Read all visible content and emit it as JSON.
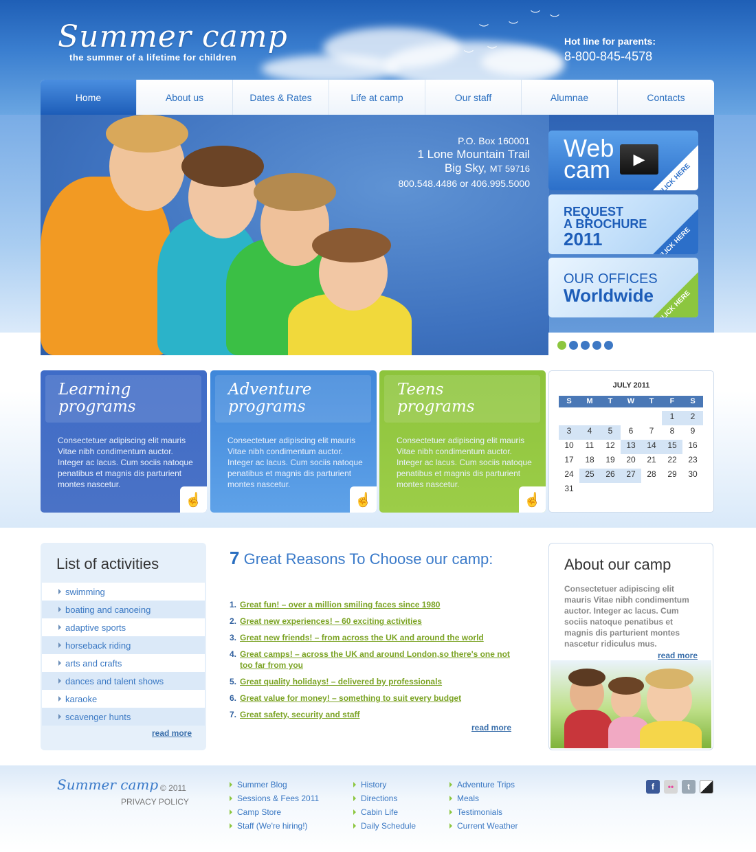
{
  "header": {
    "logo_title": "Summer camp",
    "tagline": "the summer of a lifetime for children",
    "hotline_label": "Hot line for parents:",
    "hotline_number": "8-800-845-4578"
  },
  "nav": {
    "items": [
      {
        "label": "Home",
        "active": true
      },
      {
        "label": "About us"
      },
      {
        "label": "Dates & Rates"
      },
      {
        "label": "Life at camp"
      },
      {
        "label": "Our staff"
      },
      {
        "label": "Alumnae"
      },
      {
        "label": "Contacts"
      }
    ]
  },
  "address": {
    "pobox": "P.O. Box 160001",
    "street": "1 Lone Mountain Trail",
    "city": "Big Sky,",
    "state": "MT 59716",
    "phones": "800.548.4486 or 406.995.5000"
  },
  "promos": {
    "webcam": {
      "line1": "Web",
      "line2": "cam",
      "corner": "CLICK HERE"
    },
    "brochure": {
      "line1": "REQUEST",
      "line2": "A BROCHURE",
      "line3": "2011",
      "corner": "CLICK HERE"
    },
    "offices": {
      "line1": "OUR OFFICES",
      "line2": "Worldwide",
      "corner": "CLICK HERE"
    }
  },
  "slider": {
    "count": 5,
    "active_index": 0
  },
  "cards": [
    {
      "title_l1": "Learning",
      "title_l2": "programs",
      "text": "Consectetuer adipiscing elit mauris Vitae nibh condimentum auctor. Integer ac lacus. Cum sociis natoque penatibus et magnis dis parturient montes nascetur."
    },
    {
      "title_l1": "Adventure",
      "title_l2": "programs",
      "text": "Consectetuer adipiscing elit mauris Vitae nibh condimentum auctor. Integer ac lacus. Cum sociis natoque penatibus et magnis dis parturient montes nascetur."
    },
    {
      "title_l1": "Teens",
      "title_l2": "programs",
      "text": "Consectetuer adipiscing elit mauris Vitae nibh condimentum auctor. Integer ac lacus. Cum sociis natoque penatibus et magnis dis parturient montes nascetur."
    }
  ],
  "calendar": {
    "month": "JULY 2011",
    "weekdays": [
      "S",
      "M",
      "T",
      "W",
      "T",
      "F",
      "S"
    ],
    "weeks": [
      [
        "",
        "",
        "",
        "",
        "",
        "1",
        "2"
      ],
      [
        "3",
        "4",
        "5",
        "6",
        "7",
        "8",
        "9"
      ],
      [
        "10",
        "11",
        "12",
        "13",
        "14",
        "15",
        "16"
      ],
      [
        "17",
        "18",
        "19",
        "20",
        "21",
        "22",
        "23"
      ],
      [
        "24",
        "25",
        "26",
        "27",
        "28",
        "29",
        "30"
      ],
      [
        "31",
        "",
        "",
        "",
        "",
        "",
        ""
      ]
    ],
    "highlighted": [
      "1",
      "2",
      "3",
      "4",
      "5",
      "13",
      "14",
      "15",
      "25",
      "26",
      "27"
    ]
  },
  "activities": {
    "title": "List of activities",
    "items": [
      "swimming",
      "boating and canoeing",
      "adaptive sports",
      "horseback riding",
      "arts and crafts",
      "dances and talent shows",
      "karaoke",
      "scavenger hunts"
    ],
    "read_more": "read more"
  },
  "reasons": {
    "number": "7",
    "title": "Great Reasons To Choose our camp:",
    "items": [
      "Great fun! – over a million smiling faces since 1980",
      "Great new experiences! – 60 exciting activities",
      "Great new friends! – from across the UK and around the world",
      "Great camps! – across the UK and around London,so there's one not too far from you",
      "Great quality holidays! – delivered by professionals",
      "Great value for money! – something to suit every budget",
      "Great safety, security and staff"
    ],
    "read_more": "read more"
  },
  "about": {
    "title": "About our camp",
    "text": "Consectetuer adipiscing elit mauris  Vitae nibh condimentum auctor. Integer ac lacus. Cum sociis natoque penatibus et magnis dis parturient montes nascetur ridiculus mus.",
    "read_more": "read more"
  },
  "footer": {
    "logo": "Summer camp",
    "copyright": "© 2011",
    "privacy": "PRIVACY POLICY",
    "col1": [
      "Summer Blog",
      "Sessions & Fees 2011",
      "Camp Store",
      "Staff (We're hiring!)"
    ],
    "col2": [
      "History",
      "Directions",
      "Cabin Life",
      "Daily Schedule"
    ],
    "col3": [
      "Adventure Trips",
      "Meals",
      "Testimonials",
      "Current Weather"
    ],
    "social": [
      {
        "icon": "facebook-icon",
        "glyph": "f",
        "color": "#3b5998"
      },
      {
        "icon": "flickr-icon",
        "glyph": "••",
        "color": "#d7d7d7"
      },
      {
        "icon": "twitter-icon",
        "glyph": "t",
        "color": "#9aa8b4"
      },
      {
        "icon": "delicious-icon",
        "glyph": "",
        "color": "#222222"
      }
    ]
  },
  "colors": {
    "brand_blue": "#2a6fc0",
    "accent_green": "#8cc63f"
  }
}
